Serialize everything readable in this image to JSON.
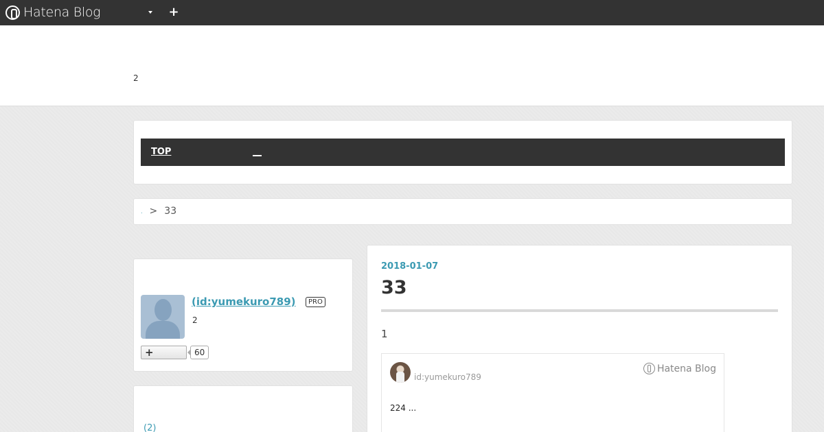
{
  "navbar": {
    "logo_text": "Hatena Blog",
    "dropdown_icon": "caret-down-icon",
    "add_icon": "plus-icon"
  },
  "header": {
    "description": "2"
  },
  "global_nav": {
    "items": [
      "TOP",
      "__"
    ]
  },
  "breadcrumb": {
    "home": ".",
    "separator": ">",
    "current": "33"
  },
  "profile": {
    "id_text": " (id:yumekuro789)",
    "badge": "PRO",
    "description": "2",
    "follow_icon": "plus-icon",
    "follow_count": "60"
  },
  "archive": {
    "link": "(2)"
  },
  "entry": {
    "date": "2018-01-07",
    "title": "33",
    "body": "1",
    "embed": {
      "user": "id:yumekuro789",
      "brand": "Hatena Blog",
      "text": "224   ..."
    }
  },
  "colors": {
    "navbar": "#333333",
    "accent": "#3b9ab2",
    "background": "#ebebeb"
  }
}
